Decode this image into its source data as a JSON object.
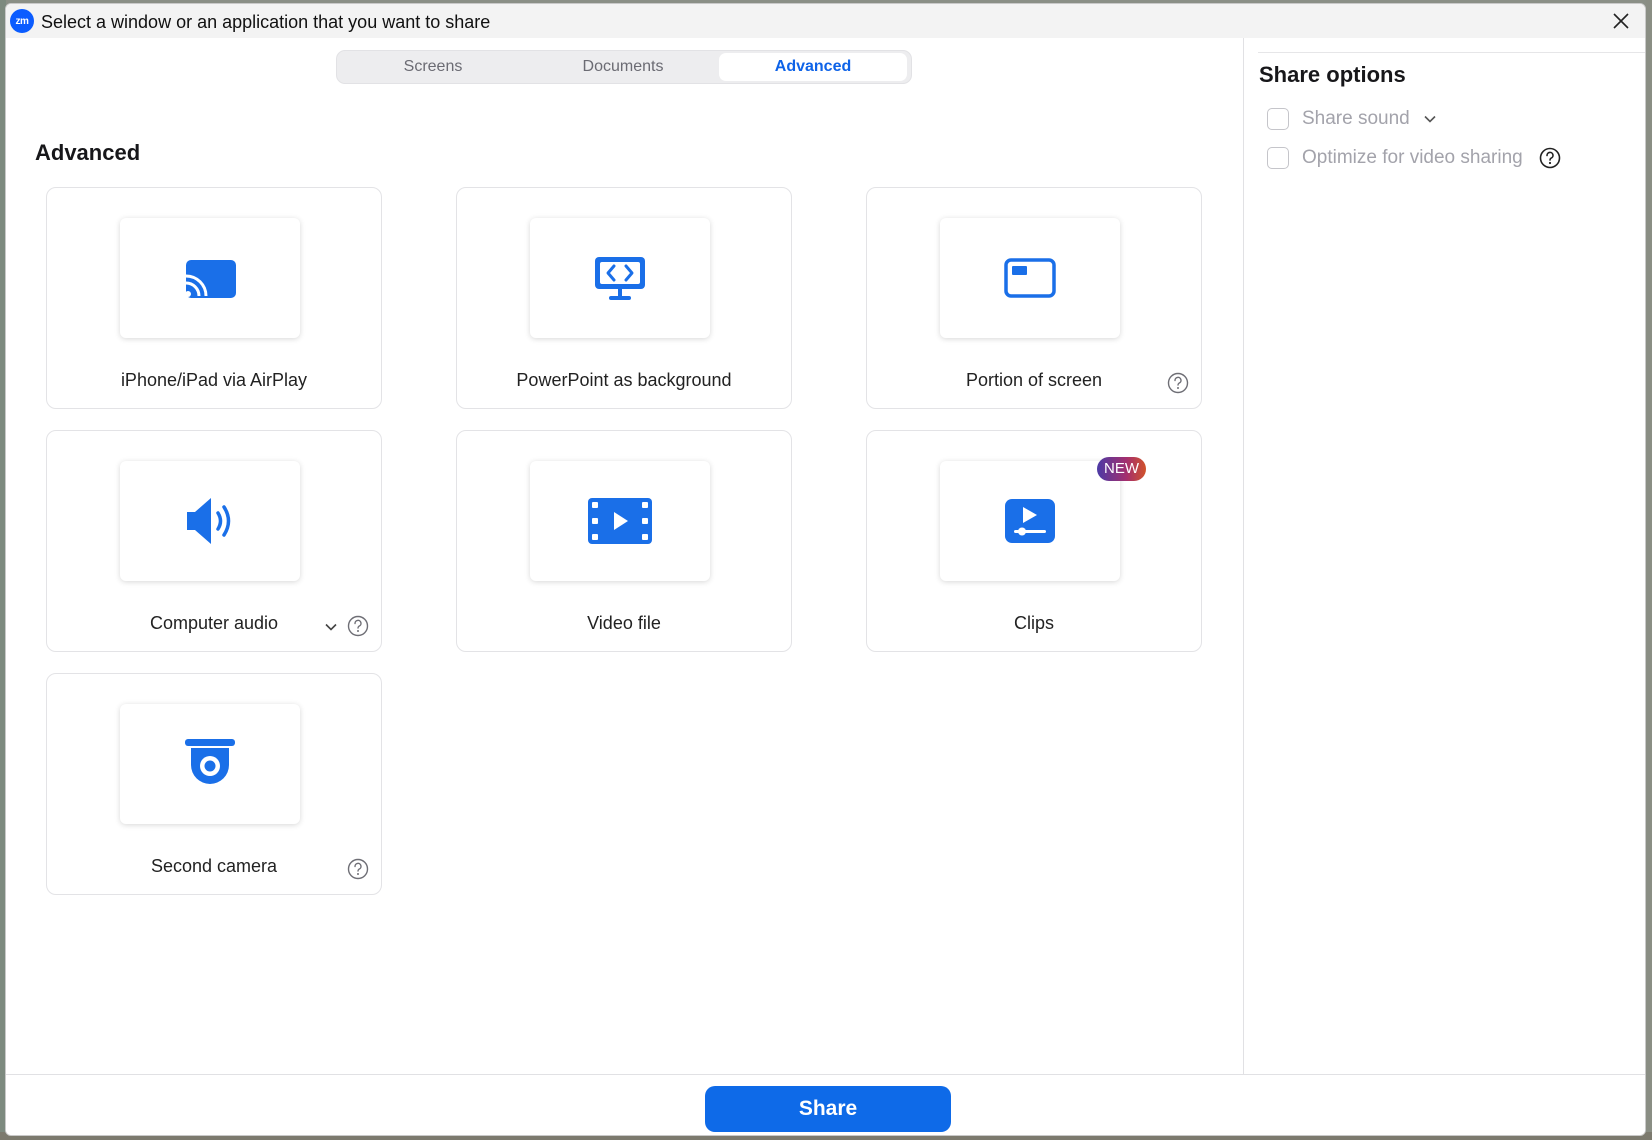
{
  "window": {
    "title": "Select a window or an application that you want to share",
    "logo_text": "zm"
  },
  "tabs": [
    {
      "label": "Screens",
      "selected": false
    },
    {
      "label": "Documents",
      "selected": false
    },
    {
      "label": "Advanced",
      "selected": true
    }
  ],
  "main": {
    "section_title": "Advanced",
    "cards": [
      {
        "label": "iPhone/iPad via AirPlay",
        "icon": "airplay-cast-icon"
      },
      {
        "label": "PowerPoint as background",
        "icon": "powerpoint-background-icon"
      },
      {
        "label": "Portion of screen",
        "icon": "screen-portion-icon",
        "help": true
      },
      {
        "label": "Computer audio",
        "icon": "speaker-icon",
        "dropdown": true,
        "help": true
      },
      {
        "label": "Video file",
        "icon": "film-strip-icon"
      },
      {
        "label": "Clips",
        "icon": "clips-icon",
        "badge": "NEW"
      },
      {
        "label": "Second camera",
        "icon": "camera-icon",
        "help": true
      }
    ]
  },
  "share_options": {
    "title": "Share options",
    "options": [
      {
        "label": "Share sound",
        "checked": false,
        "dropdown": true
      },
      {
        "label": "Optimize for video sharing",
        "checked": false,
        "help": true
      }
    ]
  },
  "footer": {
    "share_label": "Share"
  },
  "colors": {
    "accent": "#0e6ae8",
    "icon_blue": "#1a6fe8",
    "tab_selected_text": "#0e63e8",
    "disabled_text": "#a3a3ab"
  }
}
